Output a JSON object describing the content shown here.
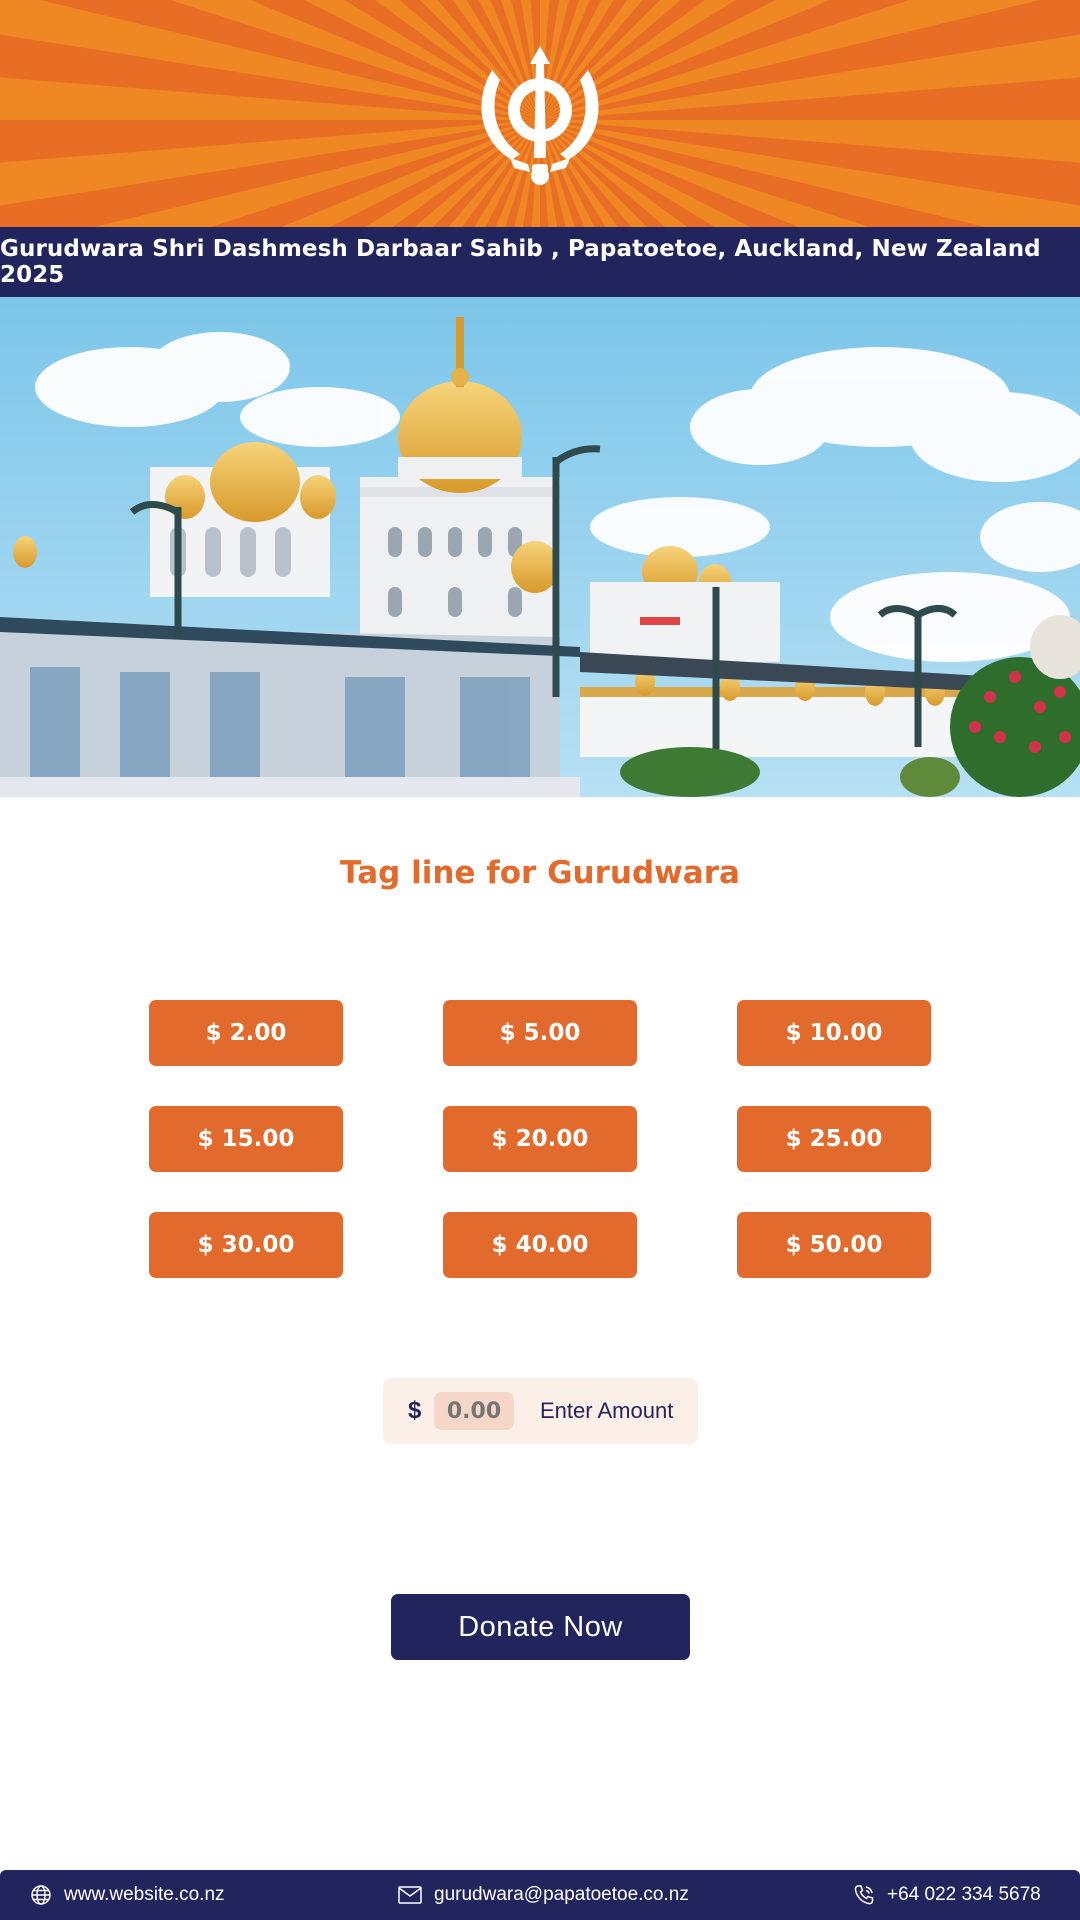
{
  "header": {
    "title": "Gurudwara Shri Dashmesh Darbaar Sahib , Papatoetoe, Auckland, New Zealand 2025",
    "logo_icon": "khanda-icon"
  },
  "tagline": "Tag line for Gurudwara",
  "amounts": [
    "$ 2.00",
    "$ 5.00",
    "$ 10.00",
    "$ 15.00",
    "$ 20.00",
    "$ 25.00",
    "$ 30.00",
    "$ 40.00",
    "$ 50.00"
  ],
  "custom_amount": {
    "currency": "$",
    "placeholder": "0.00",
    "label": "Enter Amount"
  },
  "donate_label": "Donate  Now",
  "footer": {
    "website": "www.website.co.nz",
    "email": "gurudwara@papatoetoe.co.nz",
    "phone": "+64 022 334 5678"
  },
  "colors": {
    "orange": "#e26a2c",
    "navy": "#22245e",
    "burst_light": "#ee8a24",
    "input_bg": "#fcefe8"
  }
}
